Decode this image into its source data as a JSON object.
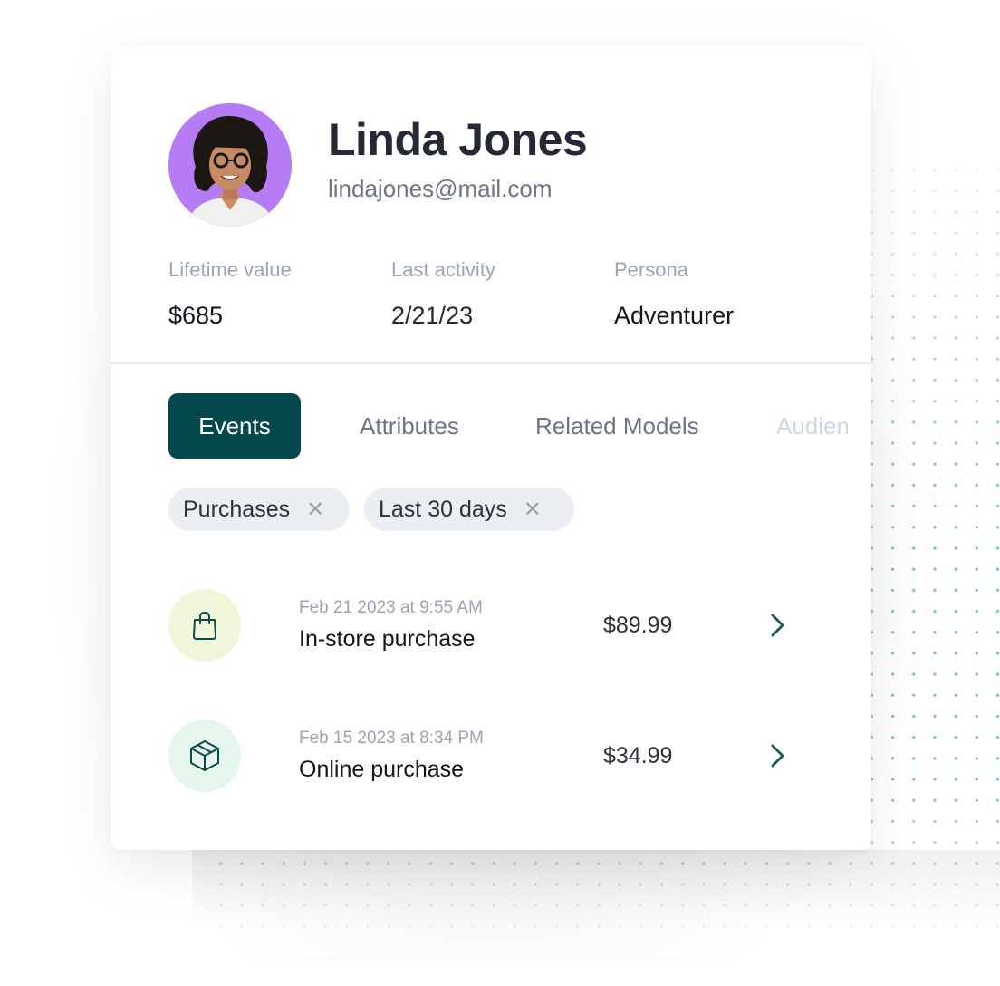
{
  "profile": {
    "name": "Linda Jones",
    "email": "lindajones@mail.com",
    "avatar": "avatar-photo",
    "avatar_bg": "#b57cf6"
  },
  "stats": [
    {
      "label": "Lifetime value",
      "value": "$685"
    },
    {
      "label": "Last activity",
      "value": "2/21/23"
    },
    {
      "label": "Persona",
      "value": "Adventurer"
    }
  ],
  "tabs": [
    {
      "label": "Events",
      "active": true
    },
    {
      "label": "Attributes",
      "active": false
    },
    {
      "label": "Related Models",
      "active": false
    },
    {
      "label": "Audiences",
      "active": false
    }
  ],
  "filters": [
    {
      "label": "Purchases",
      "remove_icon": "close-icon"
    },
    {
      "label": "Last 30 days",
      "remove_icon": "close-icon"
    }
  ],
  "events": [
    {
      "icon": "shopping-bag-icon",
      "time": "Feb 21 2023 at 9:55 AM",
      "title": "In-store purchase",
      "amount": "$89.99"
    },
    {
      "icon": "package-box-icon",
      "time": "Feb 15 2023 at 8:34 PM",
      "title": "Online purchase",
      "amount": "$34.99"
    }
  ],
  "colors": {
    "accent": "#05484b",
    "dots": "#5fbf98",
    "bag_bg": "#f0f6da",
    "box_bg": "#e5f6ec"
  }
}
